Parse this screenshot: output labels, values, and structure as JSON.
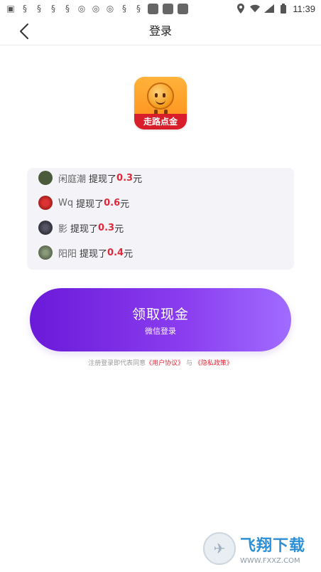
{
  "status_bar": {
    "time": "11:39",
    "left_icons": [
      "notification-icon",
      "app-icon",
      "app-icon",
      "app-icon",
      "app-icon",
      "app-icon",
      "app-icon",
      "app-icon",
      "app-icon",
      "app-icon",
      "app-icon",
      "square-icon",
      "square-icon",
      "square-icon"
    ],
    "right_icons": [
      "location-icon",
      "wifi-icon",
      "signal-icon",
      "battery-icon"
    ]
  },
  "navbar": {
    "title": "登录"
  },
  "app": {
    "icon_label": "走路点金"
  },
  "feed": {
    "action": "提现了",
    "unit": "元",
    "items": [
      {
        "name": "闲庭潮",
        "amount": "0.3"
      },
      {
        "name": "Wq",
        "amount": "0.6"
      },
      {
        "name": "影",
        "amount": "0.3"
      },
      {
        "name": "阳阳",
        "amount": "0.4"
      }
    ]
  },
  "cta": {
    "title": "领取现金",
    "subtitle": "微信登录"
  },
  "agreement": {
    "prefix": "注册登录即代表同意",
    "user_agreement": "《用户协议》",
    "and": "与",
    "privacy_policy": "《隐私政策》"
  },
  "watermark": {
    "title": "飞翔下载",
    "url": "WWW.FXXZ.COM"
  },
  "colors": {
    "accent_red": "#e0283a",
    "cta_start": "#6a1ad8",
    "cta_end": "#a06cff"
  }
}
